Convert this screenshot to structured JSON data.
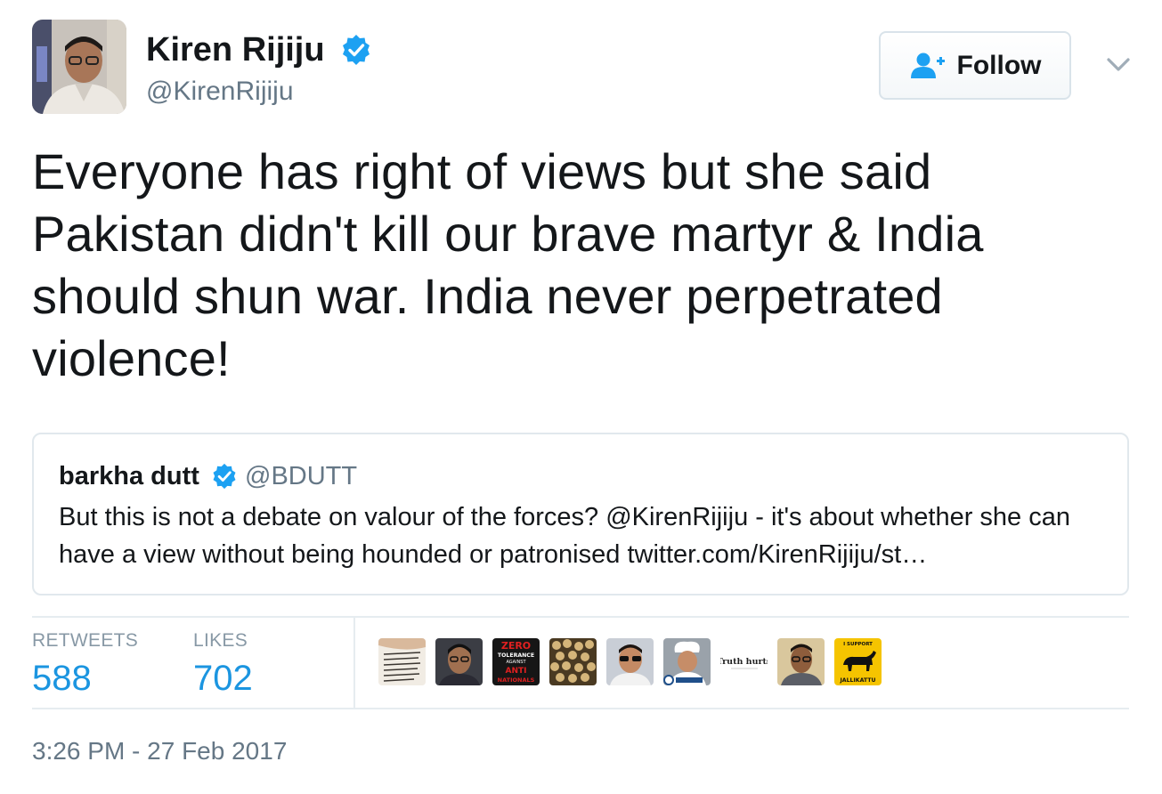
{
  "author": {
    "name": "Kiren Rijiju",
    "handle": "@KirenRijiju",
    "verified_icon": "verified-badge-icon"
  },
  "actions": {
    "follow_label": "Follow",
    "follow_icon": "add-user-icon",
    "more_icon": "chevron-down-icon"
  },
  "tweet": {
    "text": "Everyone has right of views but she said Pakistan didn't kill our brave martyr & India should shun war. India never perpetrated violence!"
  },
  "quoted_tweet": {
    "name": "barkha dutt",
    "handle": "@BDUTT",
    "text": "But this is not a debate on valour of the forces? @KirenRijiju - it's about whether she can have a view without being hounded or patronised twitter.com/KirenRijiju/st…"
  },
  "stats": {
    "retweets_label": "RETWEETS",
    "retweets_count": "588",
    "likes_label": "LIKES",
    "likes_count": "702"
  },
  "likers": [
    {
      "avatar": "text-note-avatar"
    },
    {
      "avatar": "man-portrait-avatar"
    },
    {
      "avatar": "zero-tolerance-avatar",
      "line1": "ZERO",
      "line2": "TOLERANCE",
      "line3": "AGAINST",
      "line4": "ANTI",
      "line5": "NATIONALS"
    },
    {
      "avatar": "seeds-avatar"
    },
    {
      "avatar": "man-sunglasses-avatar"
    },
    {
      "avatar": "chef-avatar"
    },
    {
      "avatar": "truth-hurts-avatar",
      "text": "Truth hurts"
    },
    {
      "avatar": "man-glasses-avatar"
    },
    {
      "avatar": "jallikattu-avatar",
      "top": "I SUPPORT",
      "bottom": "JALLIKATTU"
    }
  ],
  "timestamp": "3:26 PM - 27 Feb 2017",
  "colors": {
    "text": "#14171a",
    "secondary": "#657786",
    "link_blue": "#1b95e0",
    "verified_blue": "#1da1f2",
    "border": "#e1e8ed"
  }
}
